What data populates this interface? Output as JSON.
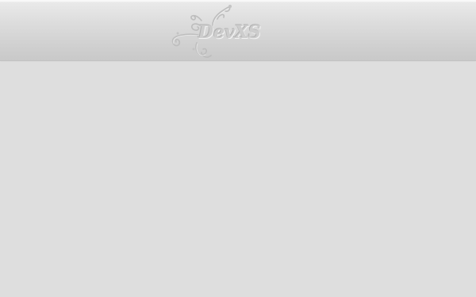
{
  "header": {
    "logo": {
      "text": "DevXS",
      "icon": "swirl-flourish-icon"
    }
  },
  "colors": {
    "background": "#dedede",
    "header_top": "#f3f3f3",
    "header_bottom": "#c9c9c9",
    "logo_text": "#cdcdcd"
  }
}
